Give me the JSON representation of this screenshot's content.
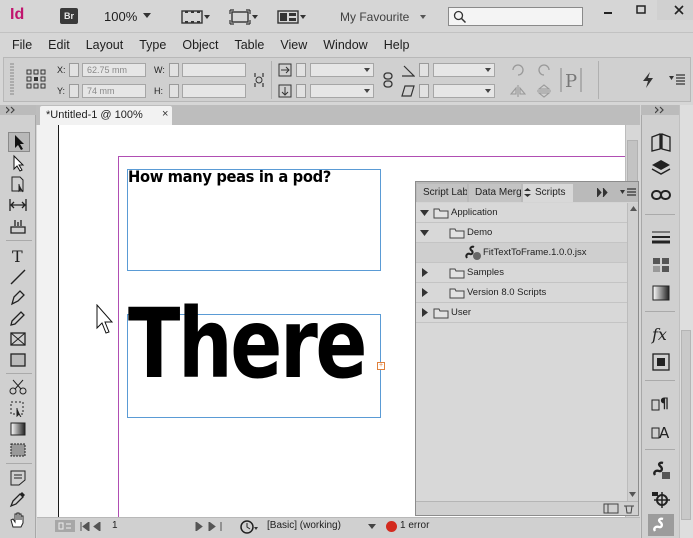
{
  "app": {
    "logo": "Id",
    "bridge": "Br",
    "zoom": "100%",
    "workspace": "My Favourite"
  },
  "menus": [
    "File",
    "Edit",
    "Layout",
    "Type",
    "Object",
    "Table",
    "View",
    "Window",
    "Help"
  ],
  "control": {
    "x_label": "X:",
    "x_value": "62.75 mm",
    "y_label": "Y:",
    "y_value": "74 mm",
    "w_label": "W:",
    "h_label": "H:"
  },
  "document": {
    "tab_title": "*Untitled-1 @ 100%",
    "close": "×"
  },
  "frames": {
    "headline": "How many peas in a pod?",
    "big_text": "There",
    "overset": "+"
  },
  "scripts_panel": {
    "tabs": [
      "Script Lab",
      "Data Merg",
      "Scripts"
    ],
    "items": [
      {
        "label": "Application",
        "level": 0,
        "expanded": true,
        "type": "folder"
      },
      {
        "label": "Demo",
        "level": 1,
        "expanded": true,
        "type": "folder"
      },
      {
        "label": "FitTextToFrame.1.0.0.jsx",
        "level": 2,
        "type": "script"
      },
      {
        "label": "Samples",
        "level": 1,
        "expanded": false,
        "type": "folder"
      },
      {
        "label": "Version 8.0 Scripts",
        "level": 1,
        "expanded": false,
        "type": "folder"
      },
      {
        "label": "User",
        "level": 0,
        "expanded": false,
        "type": "folder"
      }
    ]
  },
  "status": {
    "page": "1",
    "style": "[Basic] (working)",
    "errors": "1 error"
  },
  "colors": {
    "indesign": "#c0156e",
    "frame_border": "#5a9bd5",
    "bleed": "#b04eb3",
    "error": "#d32a1e"
  }
}
